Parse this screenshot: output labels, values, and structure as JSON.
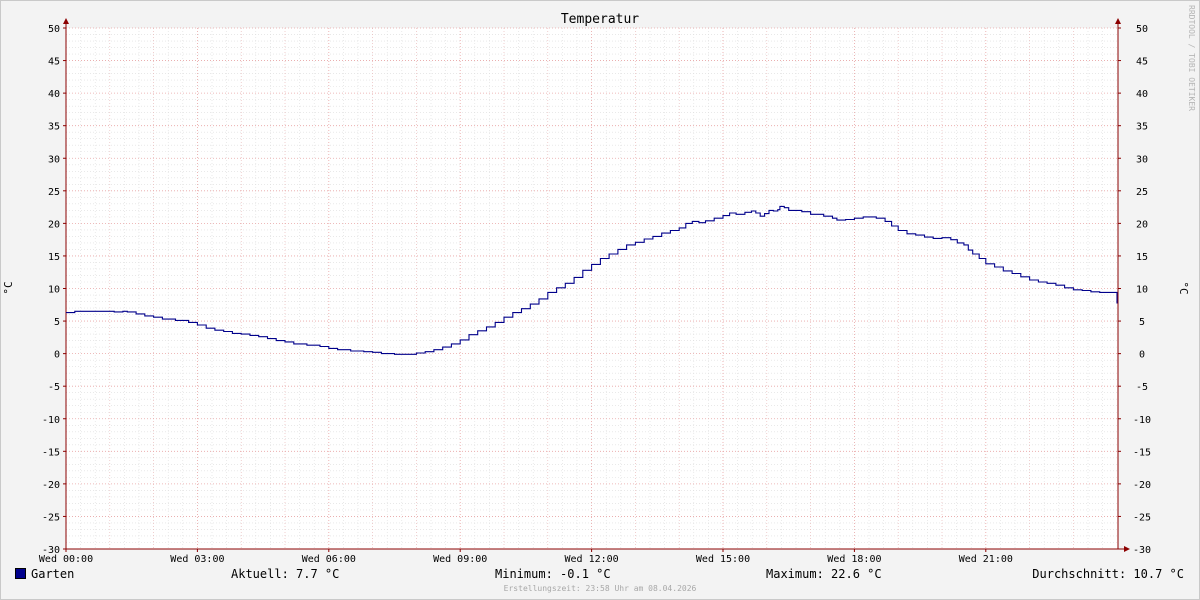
{
  "chart_data": {
    "type": "line",
    "title": "Temperatur",
    "ylabel": "°C",
    "ylim": [
      -30,
      50
    ],
    "yticks": [
      50,
      45,
      40,
      35,
      30,
      25,
      20,
      15,
      10,
      5,
      0,
      -5,
      -10,
      -15,
      -20,
      -25,
      -30
    ],
    "xlim_hours": [
      0,
      24
    ],
    "xticks": [
      {
        "h": 0,
        "label": "Wed 00:00"
      },
      {
        "h": 3,
        "label": "Wed 03:00"
      },
      {
        "h": 6,
        "label": "Wed 06:00"
      },
      {
        "h": 9,
        "label": "Wed 09:00"
      },
      {
        "h": 12,
        "label": "Wed 12:00"
      },
      {
        "h": 15,
        "label": "Wed 15:00"
      },
      {
        "h": 18,
        "label": "Wed 18:00"
      },
      {
        "h": 21,
        "label": "Wed 21:00"
      }
    ],
    "grid": true,
    "series": [
      {
        "name": "Garten",
        "color": "#00008b",
        "points": [
          [
            0.0,
            6.3
          ],
          [
            0.2,
            6.5
          ],
          [
            0.5,
            6.5
          ],
          [
            1.0,
            6.5
          ],
          [
            1.1,
            6.4
          ],
          [
            1.3,
            6.5
          ],
          [
            1.4,
            6.4
          ],
          [
            1.6,
            6.1
          ],
          [
            1.8,
            5.8
          ],
          [
            2.0,
            5.6
          ],
          [
            2.2,
            5.3
          ],
          [
            2.5,
            5.1
          ],
          [
            2.8,
            4.8
          ],
          [
            3.0,
            4.4
          ],
          [
            3.2,
            3.9
          ],
          [
            3.4,
            3.6
          ],
          [
            3.6,
            3.4
          ],
          [
            3.8,
            3.1
          ],
          [
            4.0,
            3.0
          ],
          [
            4.2,
            2.8
          ],
          [
            4.4,
            2.6
          ],
          [
            4.6,
            2.3
          ],
          [
            4.8,
            2.0
          ],
          [
            5.0,
            1.8
          ],
          [
            5.2,
            1.5
          ],
          [
            5.5,
            1.3
          ],
          [
            5.8,
            1.1
          ],
          [
            6.0,
            0.8
          ],
          [
            6.2,
            0.6
          ],
          [
            6.5,
            0.4
          ],
          [
            6.8,
            0.3
          ],
          [
            7.0,
            0.2
          ],
          [
            7.2,
            0.0
          ],
          [
            7.5,
            -0.1
          ],
          [
            7.8,
            -0.1
          ],
          [
            8.0,
            0.1
          ],
          [
            8.2,
            0.3
          ],
          [
            8.4,
            0.6
          ],
          [
            8.6,
            1.0
          ],
          [
            8.8,
            1.5
          ],
          [
            9.0,
            2.1
          ],
          [
            9.2,
            2.9
          ],
          [
            9.4,
            3.5
          ],
          [
            9.6,
            4.1
          ],
          [
            9.8,
            4.8
          ],
          [
            10.0,
            5.6
          ],
          [
            10.2,
            6.3
          ],
          [
            10.4,
            6.9
          ],
          [
            10.6,
            7.6
          ],
          [
            10.8,
            8.4
          ],
          [
            11.0,
            9.4
          ],
          [
            11.2,
            10.1
          ],
          [
            11.4,
            10.8
          ],
          [
            11.6,
            11.7
          ],
          [
            11.8,
            12.8
          ],
          [
            12.0,
            13.7
          ],
          [
            12.2,
            14.6
          ],
          [
            12.4,
            15.3
          ],
          [
            12.6,
            16.0
          ],
          [
            12.8,
            16.7
          ],
          [
            13.0,
            17.1
          ],
          [
            13.2,
            17.6
          ],
          [
            13.4,
            18.0
          ],
          [
            13.6,
            18.5
          ],
          [
            13.8,
            18.9
          ],
          [
            14.0,
            19.3
          ],
          [
            14.15,
            20.0
          ],
          [
            14.3,
            20.3
          ],
          [
            14.45,
            20.1
          ],
          [
            14.6,
            20.4
          ],
          [
            14.8,
            20.8
          ],
          [
            15.0,
            21.2
          ],
          [
            15.15,
            21.6
          ],
          [
            15.3,
            21.4
          ],
          [
            15.5,
            21.7
          ],
          [
            15.65,
            21.9
          ],
          [
            15.75,
            21.6
          ],
          [
            15.85,
            21.1
          ],
          [
            15.95,
            21.5
          ],
          [
            16.05,
            22.0
          ],
          [
            16.15,
            21.9
          ],
          [
            16.25,
            22.1
          ],
          [
            16.3,
            22.6
          ],
          [
            16.4,
            22.4
          ],
          [
            16.5,
            22.0
          ],
          [
            16.8,
            21.8
          ],
          [
            17.0,
            21.4
          ],
          [
            17.3,
            21.1
          ],
          [
            17.5,
            20.8
          ],
          [
            17.6,
            20.5
          ],
          [
            17.8,
            20.6
          ],
          [
            18.0,
            20.8
          ],
          [
            18.2,
            21.0
          ],
          [
            18.35,
            21.0
          ],
          [
            18.5,
            20.8
          ],
          [
            18.7,
            20.3
          ],
          [
            18.85,
            19.6
          ],
          [
            19.0,
            18.9
          ],
          [
            19.2,
            18.4
          ],
          [
            19.4,
            18.2
          ],
          [
            19.6,
            17.9
          ],
          [
            19.8,
            17.7
          ],
          [
            20.0,
            17.8
          ],
          [
            20.2,
            17.5
          ],
          [
            20.35,
            17.0
          ],
          [
            20.5,
            16.7
          ],
          [
            20.6,
            15.9
          ],
          [
            20.7,
            15.3
          ],
          [
            20.85,
            14.6
          ],
          [
            21.0,
            13.8
          ],
          [
            21.2,
            13.3
          ],
          [
            21.4,
            12.7
          ],
          [
            21.6,
            12.3
          ],
          [
            21.8,
            11.8
          ],
          [
            22.0,
            11.3
          ],
          [
            22.2,
            11.0
          ],
          [
            22.4,
            10.8
          ],
          [
            22.6,
            10.5
          ],
          [
            22.8,
            10.1
          ],
          [
            23.0,
            9.8
          ],
          [
            23.2,
            9.7
          ],
          [
            23.4,
            9.5
          ],
          [
            23.6,
            9.4
          ],
          [
            23.8,
            9.4
          ],
          [
            24.0,
            9.4
          ],
          [
            24.05,
            8.4
          ],
          [
            24.3,
            8.2
          ],
          [
            24.6,
            8.0
          ],
          [
            24.9,
            7.8
          ],
          [
            25.0,
            7.7
          ]
        ]
      }
    ],
    "watermark": "RRDTOOL / TOBI OETIKER"
  },
  "legend": {
    "series_name": "Garten",
    "current": "Aktuell: 7.7 °C",
    "minimum": "Minimum: -0.1 °C",
    "maximum": "Maximum: 22.6 °C",
    "average": "Durchschnitt: 10.7 °C"
  },
  "footer": "Erstellungszeit: 23:58 Uhr am 08.04.2026"
}
